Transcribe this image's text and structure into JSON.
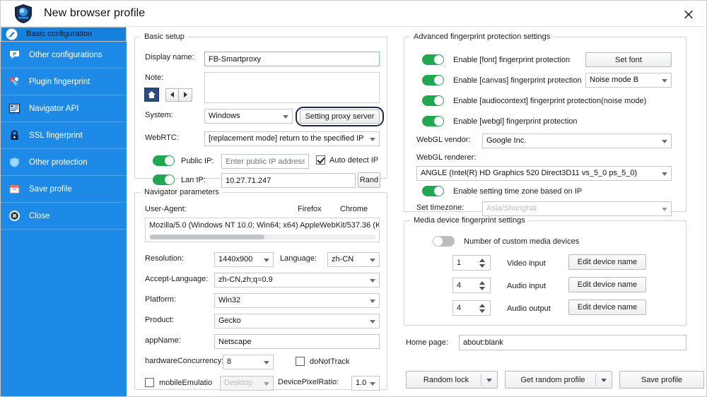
{
  "window": {
    "title": "New browser profile",
    "logo_icon": "shield-logo-icon",
    "close_icon": "close-icon"
  },
  "sidebar": {
    "items": [
      {
        "label": "Basic configuration",
        "icon": "pencil-icon",
        "selected": true
      },
      {
        "label": "Other configurations",
        "icon": "speech-bubble-icon",
        "selected": false
      },
      {
        "label": "Plugin fingerprint",
        "icon": "plugin-icon",
        "selected": false
      },
      {
        "label": "Navigator API",
        "icon": "navigator-grid-icon",
        "selected": false
      },
      {
        "label": "SSL fingerprint",
        "icon": "lock-icon",
        "selected": false
      },
      {
        "label": "Other protection",
        "icon": "shield-icon",
        "selected": false
      },
      {
        "label": "Save profile",
        "icon": "save-icon",
        "selected": false
      },
      {
        "label": "Close",
        "icon": "close-circle-icon",
        "selected": false
      }
    ]
  },
  "basic_setup": {
    "legend": "Basic setup",
    "display_name": {
      "label": "Display name:",
      "value": "FB-Smartproxy"
    },
    "note": {
      "label": "Note:",
      "value": ""
    },
    "note_home_icon": "home-icon",
    "note_prev_icon": "arrow-left-icon",
    "note_next_icon": "arrow-right-icon",
    "system": {
      "label": "System:",
      "value": "Windows"
    },
    "proxy_button": "Setting proxy server",
    "webrtc": {
      "label": "WebRTC:",
      "value": "[replacement mode] return to the specified IP"
    },
    "public_ip": {
      "label": "Public IP:",
      "toggle": "on",
      "placeholder": "Enter public IP address",
      "value": ""
    },
    "auto_detect_ip": {
      "label": "Auto detect IP",
      "checked": true
    },
    "lan_ip": {
      "label": "Lan IP:",
      "toggle": "on",
      "value": "10.27.71.247"
    },
    "rand_button": "Rand"
  },
  "navigator": {
    "legend": "Navigator parameters",
    "user_agent": {
      "label": "User-Agent:",
      "value": "Mozilla/5.0 (Windows NT 10.0; Win64; x64) AppleWebKit/537.36 (K"
    },
    "browser_tabs": [
      "Firefox",
      "Chrome"
    ],
    "resolution": {
      "label": "Resolution:",
      "value": "1440x900"
    },
    "language": {
      "label": "Language:",
      "value": "zh-CN"
    },
    "accept_language": {
      "label": "Accept-Language:",
      "value": "zh-CN,zh;q=0.9"
    },
    "platform": {
      "label": "Platform:",
      "value": "Win32"
    },
    "product": {
      "label": "Product:",
      "value": "Gecko"
    },
    "app_name": {
      "label": "appName:",
      "value": "Netscape"
    },
    "hardware_concurrency": {
      "label": "hardwareConcurrency:",
      "value": "8"
    },
    "do_not_track": {
      "label": "doNotTrack",
      "checked": false
    },
    "mobile_emulation": {
      "label": "mobileEmulatio",
      "checked": false
    },
    "mobile_device": {
      "value": "Desktop"
    },
    "device_pixel_ratio": {
      "label": "DevicePixelRatio:",
      "value": "1.0"
    }
  },
  "advanced": {
    "legend": "Advanced fingerprint protection settings",
    "font": {
      "label": "Enable [font] fingerprint protection",
      "toggle": "on"
    },
    "set_font_button": "Set font",
    "canvas": {
      "label": "Enable [canvas] fingerprint protection",
      "toggle": "on"
    },
    "canvas_mode": {
      "value": "Noise mode B"
    },
    "audiocontext": {
      "label": "Enable [audiocontext] fingerprint  protection(noise mode)",
      "toggle": "on"
    },
    "webgl": {
      "label": "Enable [webgl] fingerprint protection",
      "toggle": "on"
    },
    "webgl_vendor": {
      "label": "WebGL vendor:",
      "value": "Google Inc."
    },
    "webgl_renderer": {
      "label": "WebGL renderer:",
      "value": "ANGLE (Intel(R) HD Graphics 520 Direct3D11 vs_5_0 ps_5_0)"
    },
    "timezone_by_ip": {
      "label": "Enable setting time zone based on IP",
      "toggle": "on"
    },
    "set_timezone": {
      "label": "Set timezone:",
      "value": "Asia/Shanghai"
    }
  },
  "media": {
    "legend": "Media device fingerprint settings",
    "custom_devices": {
      "label": "Number of custom media devices",
      "toggle": "off"
    },
    "rows": [
      {
        "count": "1",
        "label": "Video input",
        "button": "Edit device name"
      },
      {
        "count": "4",
        "label": "Audio input",
        "button": "Edit device name"
      },
      {
        "count": "4",
        "label": "Audio output",
        "button": "Edit device name"
      }
    ]
  },
  "footer": {
    "home_page": {
      "label": "Home page:",
      "value": "about:blank"
    },
    "random_lock_button": "Random lock",
    "get_random_profile_button": "Get random profile",
    "save_profile_button": "Save profile"
  },
  "colors": {
    "sidebar": "#1e8ae8",
    "sidebar_selected": "#1481dd",
    "toggle_on": "#1fa84f",
    "toggle_off": "#b9bdc1",
    "focus_ring": "#1c2a52"
  }
}
